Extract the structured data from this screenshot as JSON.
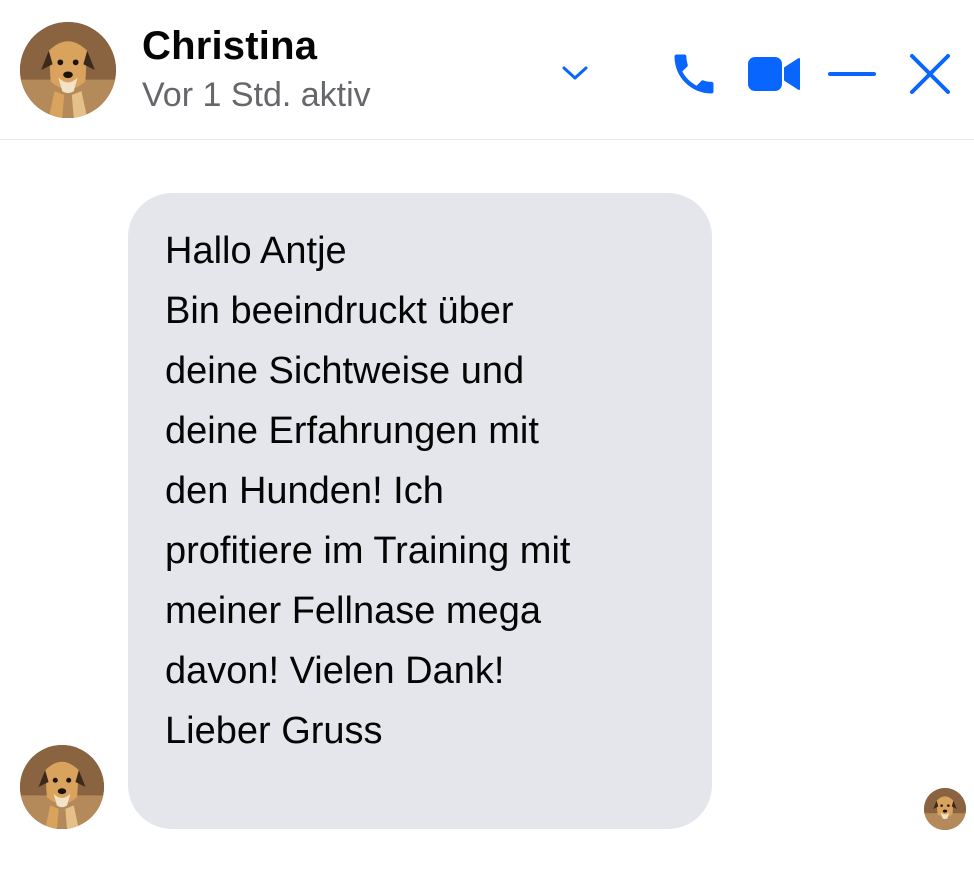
{
  "header": {
    "contact_name": "Christina",
    "status": "Vor 1 Std. aktiv",
    "icons": {
      "menu": "chevron-down-icon",
      "call": "phone-icon",
      "video": "video-camera-icon",
      "minimize": "minimize-icon",
      "close": "close-icon"
    }
  },
  "message": {
    "lines": [
      "Hallo Antje",
      "Bin beeindruckt über",
      "deine Sichtweise und",
      "deine Erfahrungen mit",
      "den Hunden! Ich",
      "profitiere im Training mit",
      "meiner Fellnase mega",
      "davon! Vielen Dank!",
      "Lieber Gruss"
    ]
  },
  "colors": {
    "accent": "#0866ff",
    "bubble": "#e4e6eb",
    "text": "#050505",
    "secondary_text": "#65676b"
  }
}
